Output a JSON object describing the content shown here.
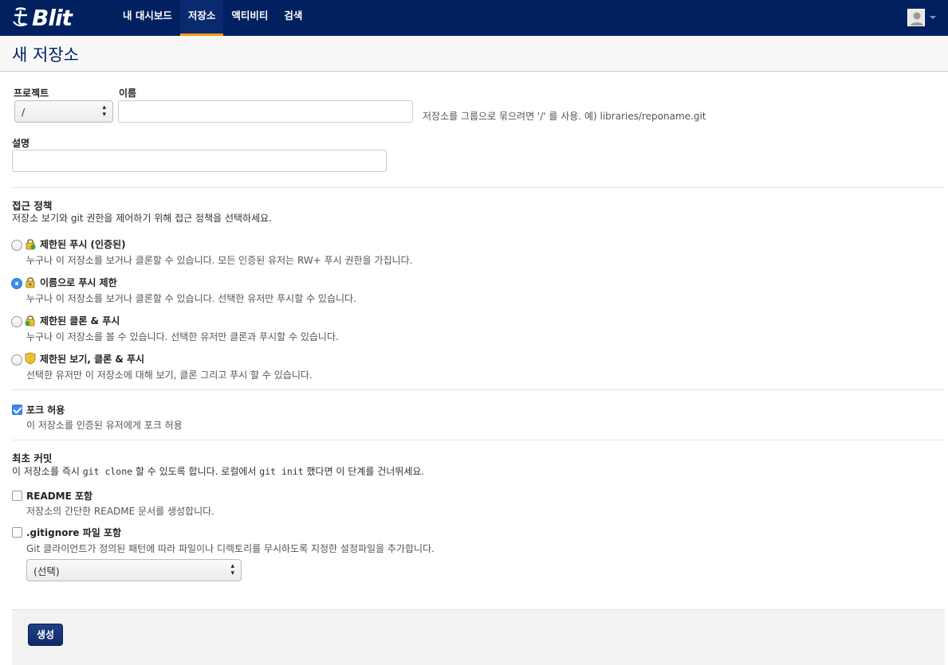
{
  "app": {
    "brand": "Blit"
  },
  "nav": {
    "items": [
      "내 대시보드",
      "저장소",
      "액티비티",
      "검색"
    ],
    "active": "저장소"
  },
  "page": {
    "title": "새 저장소"
  },
  "form": {
    "project_label": "프로젝트",
    "project_value": "/",
    "name_label": "이름",
    "name_value": "",
    "name_help": "저장소를 그룹으로 묶으려면 '/' 를 사용. 예) libraries/reponame.git",
    "description_label": "설명",
    "description_value": ""
  },
  "access": {
    "title": "접근 정책",
    "desc": "저장소 보기와 git 권한을 제어하기 위해 접근 정책을 선택하세요.",
    "options": [
      {
        "title": "제한된 푸시 (인증된)",
        "desc": "누구나 이 저장소를 보거나 클론할 수 있습니다. 모든 인증된 유저는 RW+ 푸시 권한을 가집니다.",
        "checked": false,
        "icon": "lock-icon"
      },
      {
        "title": "이름으로 푸시 제한",
        "desc": "누구나 이 저장소를 보거나 클론할 수 있습니다. 선택한 유저만 푸시할 수 있습니다.",
        "checked": true,
        "icon": "lock-icon"
      },
      {
        "title": "제한된 클론 & 푸시",
        "desc": "누구나 이 저장소를 볼 수 있습니다. 선택한 유저만 클론과 푸시할 수 있습니다.",
        "checked": false,
        "icon": "lock-icon"
      },
      {
        "title": "제한된 보기, 클론 & 푸시",
        "desc": "선택한 유저만 이 저장소에 대해 보기, 클론 그리고 푸시 할 수 있습니다.",
        "checked": false,
        "icon": "shield-icon"
      }
    ]
  },
  "fork": {
    "title": "포크 허용",
    "desc": "이 저장소를 인증된 유저에게 포크 허용",
    "checked": true
  },
  "initial_commit": {
    "title": "최초 커밋",
    "desc_1": "이 저장소를 즉시",
    "desc_code_1": "git clone",
    "desc_2": "할 수 있도록 합니다. 로컬에서",
    "desc_code_2": "git init",
    "desc_3": "했다면 이 단계를 건너뛰세요.",
    "readme_title": "README 포함",
    "readme_desc": "저장소의 간단한 README 문서를 생성합니다.",
    "readme_checked": false,
    "gitignore_title": ".gitignore 파일 포함",
    "gitignore_desc": "Git 클라이언트가 정의된 패턴에 따라 파일이나 디렉토리를 무시하도록 지정한 설정파일을 추가합니다.",
    "gitignore_checked": false,
    "gitignore_select": "(선택)"
  },
  "actions": {
    "create_label": "생성"
  },
  "colors": {
    "navbar": "#002060",
    "accent": "#f39c12",
    "primary_button": "#1a3a80"
  }
}
